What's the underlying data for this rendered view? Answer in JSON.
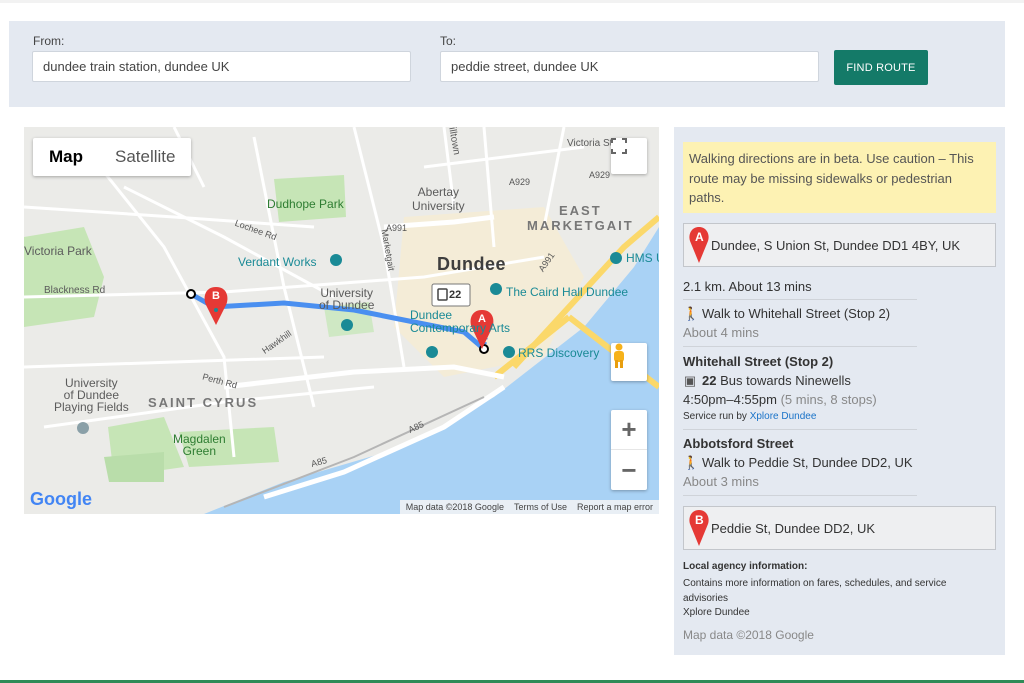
{
  "search": {
    "from_label": "From:",
    "from_value": "dundee train station, dundee UK",
    "to_label": "To:",
    "to_value": "peddie street, dundee UK",
    "find_button": "FIND ROUTE"
  },
  "map": {
    "type_map": "Map",
    "type_satellite": "Satellite",
    "zoom_in": "+",
    "zoom_out": "−",
    "route_color": "#4a8ff0",
    "marker_color": "#e53935",
    "bus_number": "22",
    "labels": {
      "victoria_street": "Victoria St",
      "hilltown": "Hilltown",
      "abertay": "Abertay\nUniversity",
      "dudhope_park": "Dudhope Park",
      "east_marketgait": "EAST\nMARKETGAIT",
      "lochee_rd": "Lochee Rd",
      "a991_a": "A991",
      "a929_a": "A929",
      "a929_b": "A929",
      "victoria_park": "Victoria Park",
      "verdant_works": "Verdant Works",
      "dundee": "Dundee",
      "hms": "HMS U",
      "marketgait": "Marketgait",
      "a991_b": "A991",
      "blackness_rd": "Blackness Rd",
      "uni_dundee": "University\nof Dundee",
      "caird_hall": "The Caird Hall Dundee",
      "dundee_contemporary": "Dundee\nContemporary Arts",
      "hawkhill": "Hawkhill",
      "rrs_discovery": "RRS Discovery",
      "perth_rd": "Perth Rd",
      "uni_playing": "University\nof Dundee\nPlaying Fields",
      "saint_cyrus": "SAINT CYRUS",
      "a85_a": "A85",
      "magdalen_green": "Magdalen\nGreen",
      "a85_b": "A85"
    },
    "marker_a": "A",
    "marker_b": "B",
    "google": "Google",
    "footer_data": "Map data ©2018 Google",
    "footer_terms": "Terms of Use",
    "footer_report": "Report a map error"
  },
  "directions": {
    "warning": "Walking directions are in beta. Use caution – This route may be missing sidewalks or pedestrian paths.",
    "start_marker": "A",
    "start": "Dundee, S Union St, Dundee DD1 4BY, UK",
    "summary": "2.1 km. About 13 mins",
    "step1": "Walk to Whitehall Street (Stop 2)",
    "step1_time": "About 4 mins",
    "stop_title": "Whitehall Street (Stop 2)",
    "bus_number": "22",
    "bus_text": "Bus towards Ninewells",
    "bus_times": "4:50pm–4:55pm",
    "bus_detail": "(5 mins, 8 stops)",
    "service_prefix": "Service run by",
    "service_operator": "Xplore Dundee",
    "stop2_title": "Abbotsford Street",
    "step2": "Walk to Peddie St, Dundee DD2, UK",
    "step2_time": "About 3 mins",
    "end_marker": "B",
    "end": "Peddie St, Dundee DD2, UK",
    "agency_title": "Local agency information:",
    "agency_text": "Contains more information on fares, schedules, and service advisories",
    "agency_link": "Xplore Dundee",
    "map_data": "Map data ©2018 Google"
  }
}
